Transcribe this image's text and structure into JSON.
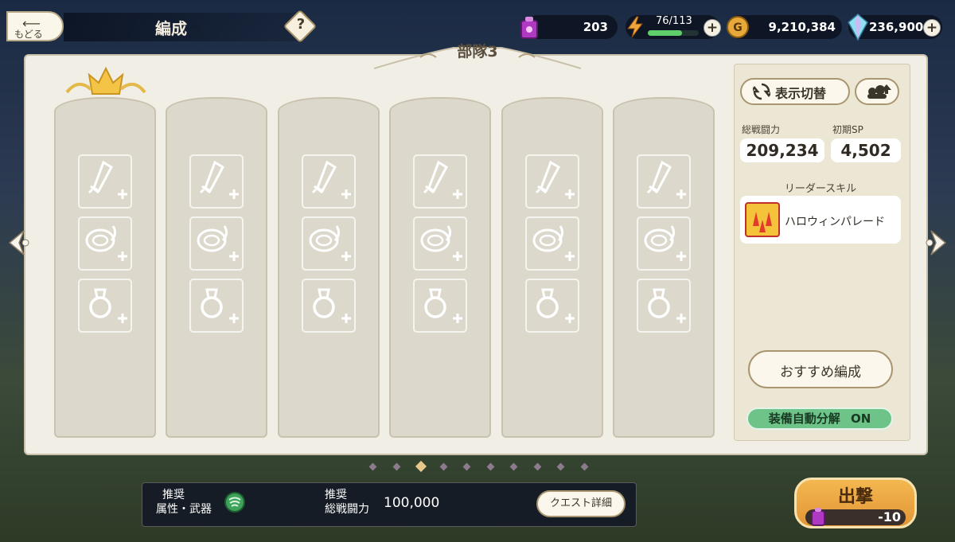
{
  "header": {
    "back_label": "もどる",
    "title": "編成",
    "help_symbol": "?"
  },
  "resources": {
    "item_count": "203",
    "stamina": "76/113",
    "stamina_fraction": 0.67,
    "gold": "9,210,384",
    "gems": "236,900",
    "accent_stamina": "#f2a53a",
    "accent_gem": "#7fd6e8"
  },
  "team": {
    "title": "部隊3",
    "pages": 10,
    "active_page": 2
  },
  "slots": {
    "columns": 6,
    "slot_types": [
      "weapon-plus-icon",
      "armor-plus-icon",
      "accessory-plus-icon"
    ]
  },
  "side": {
    "toggle_view_label": "表示切替",
    "total_power_label": "総戦闘力",
    "total_power_value": "209,234",
    "initial_sp_label": "初期SP",
    "initial_sp_value": "4,502",
    "leader_skill_label": "リーダースキル",
    "leader_skill_name": "ハロウィンパレード",
    "recommend_label": "おすすめ編成",
    "auto_disassemble_label": "装備自動分解",
    "auto_disassemble_state": "ON"
  },
  "bottom": {
    "recommended_label_1": "推奨",
    "element_weapon_label": "属性・武器",
    "recommended_label_2": "推奨",
    "total_power_label": "総戦闘力",
    "recommended_power": "100,000",
    "quest_details_label": "クエスト詳細",
    "sortie_label": "出撃",
    "sortie_cost": "-10"
  }
}
